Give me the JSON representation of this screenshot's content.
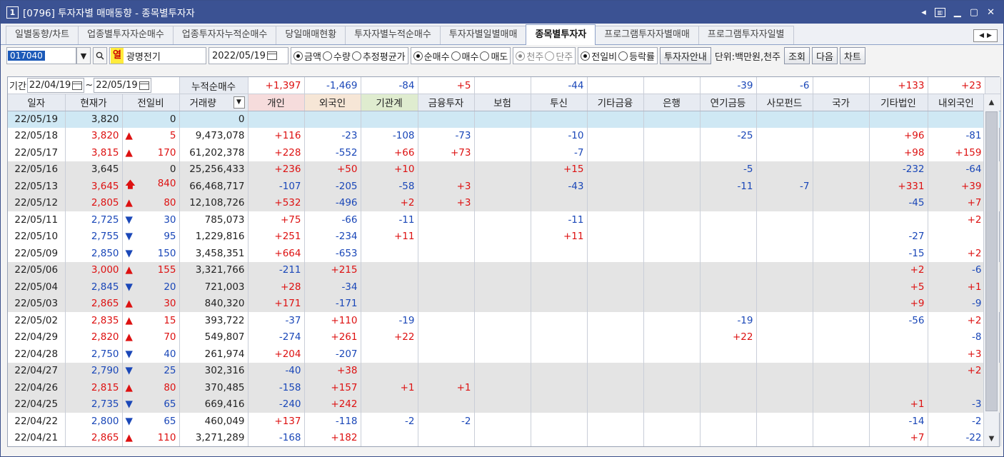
{
  "title": {
    "num": "1",
    "text": "[0796] 투자자별 매매동향 - 종목별투자자"
  },
  "tabs": [
    "일별동향/차트",
    "업종별투자자순매수",
    "업종투자자누적순매수",
    "당일매매현황",
    "투자자별누적순매수",
    "투자자별일별매매",
    "종목별투자자",
    "프로그램투자자별매매",
    "프로그램투자자일별"
  ],
  "active_tab": "종목별투자자",
  "toolbar": {
    "code": "017040",
    "flag": "열",
    "name": "광명전기",
    "date": "2022/05/19",
    "r1": [
      "금액",
      "수량",
      "추정평균가"
    ],
    "r2": [
      "순매수",
      "매수",
      "매도"
    ],
    "r3": [
      "천주",
      "단주"
    ],
    "r4": [
      "전일비",
      "등락률"
    ],
    "guide": "투자자안내",
    "unit": "단위:백만원,천주",
    "btn_query": "조회",
    "btn_next": "다음",
    "btn_chart": "차트"
  },
  "period": {
    "label": "기간",
    "from": "22/04/19",
    "tilde": "~",
    "to": "22/05/19",
    "cum_label": "누적순매수"
  },
  "summary": [
    "+1,397",
    "-1,469",
    "-84",
    "+5",
    "",
    "-44",
    "",
    "",
    "-39",
    "-6",
    "",
    "+133",
    "+23"
  ],
  "columns": [
    "일자",
    "현재가",
    "전일비",
    "거래량",
    "개인",
    "외국인",
    "기관계",
    "금융투자",
    "보험",
    "투신",
    "기타금융",
    "은행",
    "연기금등",
    "사모펀드",
    "국가",
    "기타법인",
    "내외국인"
  ],
  "rows": [
    {
      "d": "22/05/19",
      "p": "3,820",
      "s": "",
      "c": "0",
      "v": "0",
      "i": [
        "",
        "",
        "",
        "",
        "",
        "",
        "",
        "",
        "",
        "",
        "",
        "",
        ""
      ]
    },
    {
      "d": "22/05/18",
      "p": "3,820",
      "s": "up",
      "c": "5",
      "v": "9,473,078",
      "i": [
        "+116",
        "-23",
        "-108",
        "-73",
        "",
        "-10",
        "",
        "",
        "-25",
        "",
        "",
        "+96",
        "-81"
      ]
    },
    {
      "d": "22/05/17",
      "p": "3,815",
      "s": "up",
      "c": "170",
      "v": "61,202,378",
      "i": [
        "+228",
        "-552",
        "+66",
        "+73",
        "",
        "-7",
        "",
        "",
        "",
        "",
        "",
        "+98",
        "+159"
      ]
    },
    {
      "d": "22/05/16",
      "p": "3,645",
      "s": "",
      "c": "0",
      "v": "25,256,433",
      "i": [
        "+236",
        "+50",
        "+10",
        "",
        "",
        "+15",
        "",
        "",
        "-5",
        "",
        "",
        "-232",
        "-64"
      ]
    },
    {
      "d": "22/05/13",
      "p": "3,645",
      "s": "upper",
      "c": "840",
      "v": "66,468,717",
      "i": [
        "-107",
        "-205",
        "-58",
        "+3",
        "",
        "-43",
        "",
        "",
        "-11",
        "-7",
        "",
        "+331",
        "+39"
      ]
    },
    {
      "d": "22/05/12",
      "p": "2,805",
      "s": "up",
      "c": "80",
      "v": "12,108,726",
      "i": [
        "+532",
        "-496",
        "+2",
        "+3",
        "",
        "",
        "",
        "",
        "",
        "",
        "",
        "-45",
        "+7"
      ]
    },
    {
      "d": "22/05/11",
      "p": "2,725",
      "s": "dn",
      "c": "30",
      "v": "785,073",
      "i": [
        "+75",
        "-66",
        "-11",
        "",
        "",
        "-11",
        "",
        "",
        "",
        "",
        "",
        "",
        "+2"
      ]
    },
    {
      "d": "22/05/10",
      "p": "2,755",
      "s": "dn",
      "c": "95",
      "v": "1,229,816",
      "i": [
        "+251",
        "-234",
        "+11",
        "",
        "",
        "+11",
        "",
        "",
        "",
        "",
        "",
        "-27",
        ""
      ]
    },
    {
      "d": "22/05/09",
      "p": "2,850",
      "s": "dn",
      "c": "150",
      "v": "3,458,351",
      "i": [
        "+664",
        "-653",
        "",
        "",
        "",
        "",
        "",
        "",
        "",
        "",
        "",
        "-15",
        "+2"
      ]
    },
    {
      "d": "22/05/06",
      "p": "3,000",
      "s": "up",
      "c": "155",
      "v": "3,321,766",
      "i": [
        "-211",
        "+215",
        "",
        "",
        "",
        "",
        "",
        "",
        "",
        "",
        "",
        "+2",
        "-6"
      ]
    },
    {
      "d": "22/05/04",
      "p": "2,845",
      "s": "dn",
      "c": "20",
      "v": "721,003",
      "i": [
        "+28",
        "-34",
        "",
        "",
        "",
        "",
        "",
        "",
        "",
        "",
        "",
        "+5",
        "+1"
      ]
    },
    {
      "d": "22/05/03",
      "p": "2,865",
      "s": "up",
      "c": "30",
      "v": "840,320",
      "i": [
        "+171",
        "-171",
        "",
        "",
        "",
        "",
        "",
        "",
        "",
        "",
        "",
        "+9",
        "-9"
      ]
    },
    {
      "d": "22/05/02",
      "p": "2,835",
      "s": "up",
      "c": "15",
      "v": "393,722",
      "i": [
        "-37",
        "+110",
        "-19",
        "",
        "",
        "",
        "",
        "",
        "-19",
        "",
        "",
        "-56",
        "+2"
      ]
    },
    {
      "d": "22/04/29",
      "p": "2,820",
      "s": "up",
      "c": "70",
      "v": "549,807",
      "i": [
        "-274",
        "+261",
        "+22",
        "",
        "",
        "",
        "",
        "",
        "+22",
        "",
        "",
        "",
        "-8"
      ]
    },
    {
      "d": "22/04/28",
      "p": "2,750",
      "s": "dn",
      "c": "40",
      "v": "261,974",
      "i": [
        "+204",
        "-207",
        "",
        "",
        "",
        "",
        "",
        "",
        "",
        "",
        "",
        "",
        "+3"
      ]
    },
    {
      "d": "22/04/27",
      "p": "2,790",
      "s": "dn",
      "c": "25",
      "v": "302,316",
      "i": [
        "-40",
        "+38",
        "",
        "",
        "",
        "",
        "",
        "",
        "",
        "",
        "",
        "",
        "+2"
      ]
    },
    {
      "d": "22/04/26",
      "p": "2,815",
      "s": "up",
      "c": "80",
      "v": "370,485",
      "i": [
        "-158",
        "+157",
        "+1",
        "+1",
        "",
        "",
        "",
        "",
        "",
        "",
        "",
        "",
        ""
      ]
    },
    {
      "d": "22/04/25",
      "p": "2,735",
      "s": "dn",
      "c": "65",
      "v": "669,416",
      "i": [
        "-240",
        "+242",
        "",
        "",
        "",
        "",
        "",
        "",
        "",
        "",
        "",
        "+1",
        "-3"
      ]
    },
    {
      "d": "22/04/22",
      "p": "2,800",
      "s": "dn",
      "c": "65",
      "v": "460,049",
      "i": [
        "+137",
        "-118",
        "-2",
        "-2",
        "",
        "",
        "",
        "",
        "",
        "",
        "",
        "-14",
        "-2"
      ]
    },
    {
      "d": "22/04/21",
      "p": "2,865",
      "s": "up",
      "c": "110",
      "v": "3,271,289",
      "i": [
        "-168",
        "+182",
        "",
        "",
        "",
        "",
        "",
        "",
        "",
        "",
        "",
        "+7",
        "-22"
      ]
    }
  ]
}
